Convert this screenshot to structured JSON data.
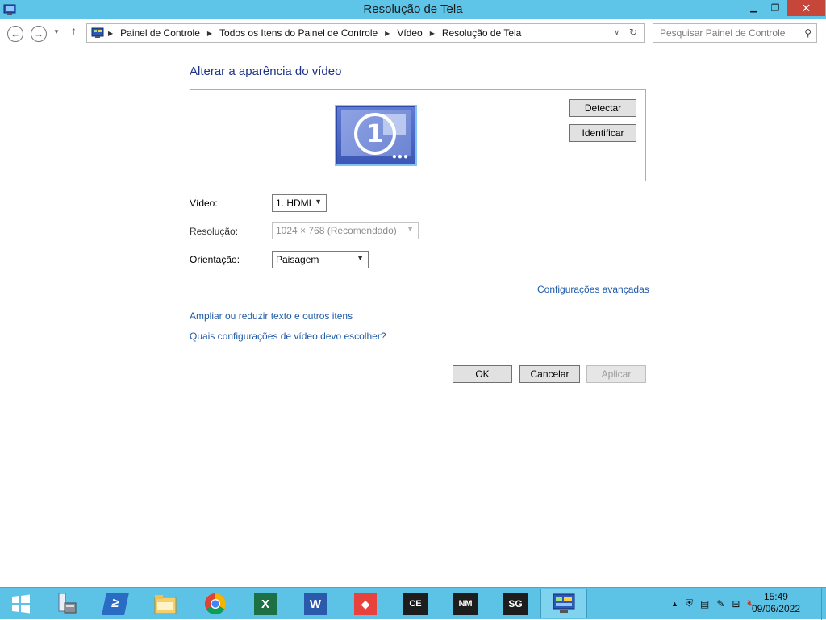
{
  "window": {
    "title": "Resolução de Tela",
    "minimize": "▁",
    "restore": "❐",
    "close": "✕"
  },
  "address": {
    "breadcrumbs": [
      "Painel de Controle",
      "Todos os Itens do Painel de Controle",
      "Vídeo",
      "Resolução de Tela"
    ],
    "search_placeholder": "Pesquisar Painel de Controle"
  },
  "main": {
    "heading": "Alterar a aparência do vídeo",
    "monitor_number": "1",
    "detect_label": "Detectar",
    "identify_label": "Identificar",
    "video_label": "Vídeo:",
    "video_value": "1. HDMI",
    "resolution_label": "Resolução:",
    "resolution_value": "1024 × 768 (Recomendado)",
    "orientation_label": "Orientação:",
    "orientation_value": "Paisagem",
    "advanced_link": "Configurações avançadas",
    "text_size_link": "Ampliar ou reduzir texto e outros itens",
    "help_link": "Quais configurações de vídeo devo escolher?",
    "ok_label": "OK",
    "cancel_label": "Cancelar",
    "apply_label": "Aplicar"
  },
  "taskbar": {
    "apps": [
      {
        "name": "start-button",
        "glyph": ""
      },
      {
        "name": "server-manager",
        "glyph": ""
      },
      {
        "name": "powershell",
        "glyph": "≥"
      },
      {
        "name": "file-explorer",
        "glyph": ""
      },
      {
        "name": "chrome",
        "glyph": ""
      },
      {
        "name": "excel",
        "glyph": "X"
      },
      {
        "name": "word",
        "glyph": "W"
      },
      {
        "name": "anydesk",
        "glyph": "◆"
      },
      {
        "name": "ce-app",
        "glyph": "CE"
      },
      {
        "name": "nm-app",
        "glyph": "NM"
      },
      {
        "name": "sg-app",
        "glyph": "SG"
      },
      {
        "name": "control-panel",
        "glyph": ""
      }
    ],
    "time": "15:49",
    "date": "09/06/2022"
  },
  "colors": {
    "titlebar": "#5fc5e8",
    "taskbar": "#5cc3e6",
    "heading": "#1e3287",
    "link": "#1e5aa8"
  }
}
